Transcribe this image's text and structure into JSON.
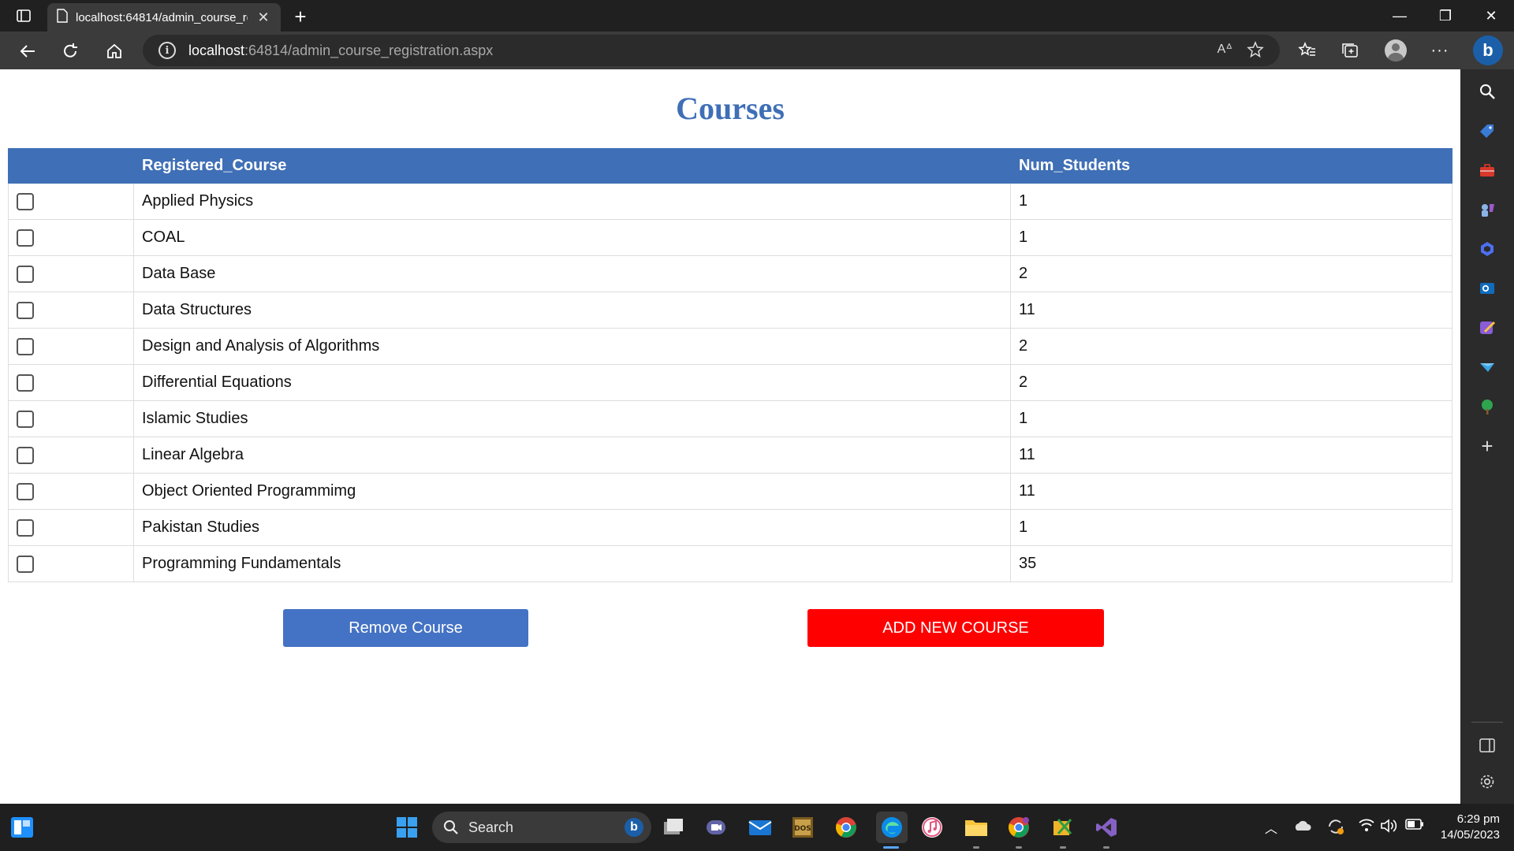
{
  "browser": {
    "tab_title": "localhost:64814/admin_course_re",
    "address_host": "localhost",
    "address_path": ":64814/admin_course_registration.aspx"
  },
  "page": {
    "title": "Courses",
    "table": {
      "headers": [
        "",
        "Registered_Course",
        "Num_Students"
      ],
      "rows": [
        {
          "course": "Applied Physics",
          "students": "1"
        },
        {
          "course": "COAL",
          "students": "1"
        },
        {
          "course": "Data Base",
          "students": "2"
        },
        {
          "course": "Data Structures",
          "students": "11"
        },
        {
          "course": "Design and Analysis of Algorithms",
          "students": "2"
        },
        {
          "course": "Differential Equations",
          "students": "2"
        },
        {
          "course": "Islamic Studies",
          "students": "1"
        },
        {
          "course": "Linear Algebra",
          "students": "11"
        },
        {
          "course": "Object Oriented Programmimg",
          "students": "11"
        },
        {
          "course": "Pakistan Studies",
          "students": "1"
        },
        {
          "course": "Programming Fundamentals",
          "students": "35"
        }
      ]
    },
    "remove_button": "Remove Course",
    "add_button": "ADD NEW COURSE"
  },
  "taskbar": {
    "search_placeholder": "Search",
    "time": "6:29 pm",
    "date": "14/05/2023"
  },
  "colors": {
    "accent": "#3f6fb6",
    "remove_button": "#4472c4",
    "add_button": "#ff0000"
  }
}
